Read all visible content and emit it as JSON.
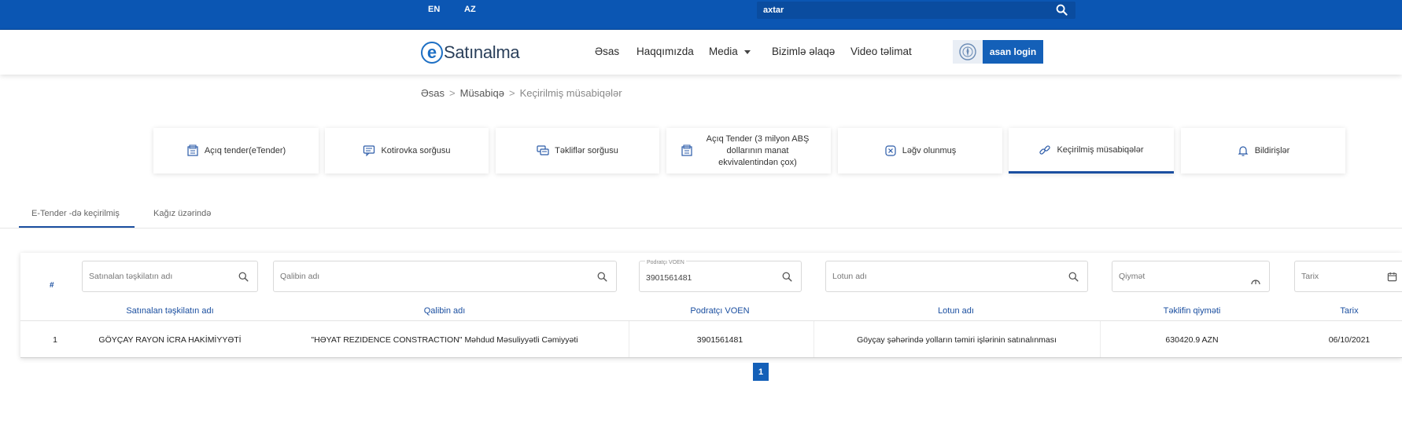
{
  "topbar": {
    "languages": [
      "EN",
      "AZ"
    ],
    "search_value": "axtar"
  },
  "header": {
    "logo_letter": "e",
    "logo_text": "Satınalma",
    "nav": [
      "Əsas",
      "Haqqımızda",
      "Media",
      "Bizimlə əlaqə",
      "Video təlimat"
    ],
    "login_label": "asan login"
  },
  "breadcrumb": [
    "Əsas",
    "Müsabiqə",
    "Keçirilmiş müsabiqələr"
  ],
  "cards": [
    {
      "label": "Açıq tender(eTender)",
      "icon": "tender-doc-icon"
    },
    {
      "label": "Kotirovka sorğusu",
      "icon": "quote-message-icon"
    },
    {
      "label": "Təkliflər sorğusu",
      "icon": "offers-chat-icon"
    },
    {
      "label": "Açıq Tender (3 milyon ABŞ dollarının manat ekvivalentindən çox)",
      "icon": "tender-doc-icon"
    },
    {
      "label": "Ləğv olunmuş",
      "icon": "cancel-x-icon"
    },
    {
      "label": "Keçirilmiş müsabiqələr",
      "icon": "link-icon",
      "active": true
    },
    {
      "label": "Bildirişlər",
      "icon": "bell-icon"
    }
  ],
  "subtabs": [
    "E-Tender -də keçirilmiş",
    "Kağız üzərində"
  ],
  "filters": {
    "org": {
      "placeholder": "Satınalan təşkilatın adı",
      "value": ""
    },
    "template": {
      "placeholder": "Qalibin adı",
      "value": ""
    },
    "voen": {
      "label": "Podratçı VOEN",
      "value": "3901561481"
    },
    "lot": {
      "placeholder": "Lotun adı",
      "value": ""
    },
    "price": {
      "placeholder": "Qiymət",
      "value": ""
    },
    "date": {
      "placeholder": "Tarix",
      "value": ""
    }
  },
  "table": {
    "hash": "#",
    "headers": [
      "Satınalan təşkilatın adı",
      "Qalibin adı",
      "Podratçı VOEN",
      "Lotun adı",
      "Təklifin qiyməti",
      "Tarix"
    ],
    "rows": [
      {
        "num": "1",
        "org": "GÖYÇAY RAYON İCRA HAKİMİYYƏTİ",
        "winner": "\"HƏYAT REZIDENCE CONSTRACTION\" Məhdud Məsuliyyətli Cəmiyyəti",
        "voen": "3901561481",
        "lot": "Göyçay şəhərində yolların təmiri işlərinin satınalınması",
        "price": "630420.9 AZN",
        "date": "06/10/2021"
      }
    ]
  },
  "pagination": {
    "current": "1"
  },
  "colors": {
    "primary": "#0b56b3",
    "accent": "#1b4fa0",
    "button": "#1460b8"
  }
}
